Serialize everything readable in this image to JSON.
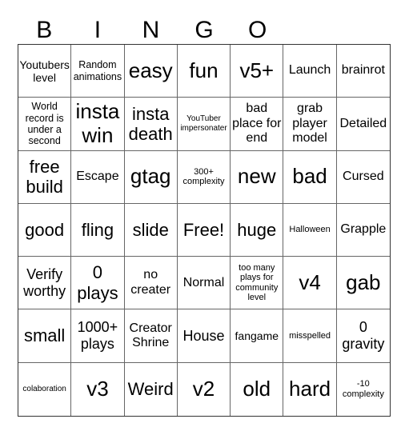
{
  "header": {
    "letters": [
      "B",
      "I",
      "N",
      "G",
      "O"
    ]
  },
  "grid": {
    "columns": 7,
    "rows": 7,
    "cells": [
      "Youtubers level",
      "Random animations",
      "easy",
      "fun",
      "v5+",
      "Launch",
      "brainrot",
      "World record is under a second",
      "insta win",
      "insta death",
      "YouTuber impersonater",
      "bad place for end",
      "grab player model",
      "Detailed",
      "free build",
      "Escape",
      "gtag",
      "300+ complexity",
      "new",
      "bad",
      "Cursed",
      "good",
      "fling",
      "slide",
      "Free!",
      "huge",
      "Halloween",
      "Grapple",
      "Verify worthy",
      "0 plays",
      "no creater",
      "Normal",
      "too many plays for community level",
      "v4",
      "gab",
      "small",
      "1000+ plays",
      "Creator Shrine",
      "House",
      "fangame",
      "misspelled",
      "0 gravity",
      "colaboration",
      "v3",
      "Weird",
      "v2",
      "old",
      "hard",
      "-10 complexity"
    ]
  },
  "colors": {
    "text": "#000000",
    "border": "#666666",
    "background": "#ffffff"
  }
}
